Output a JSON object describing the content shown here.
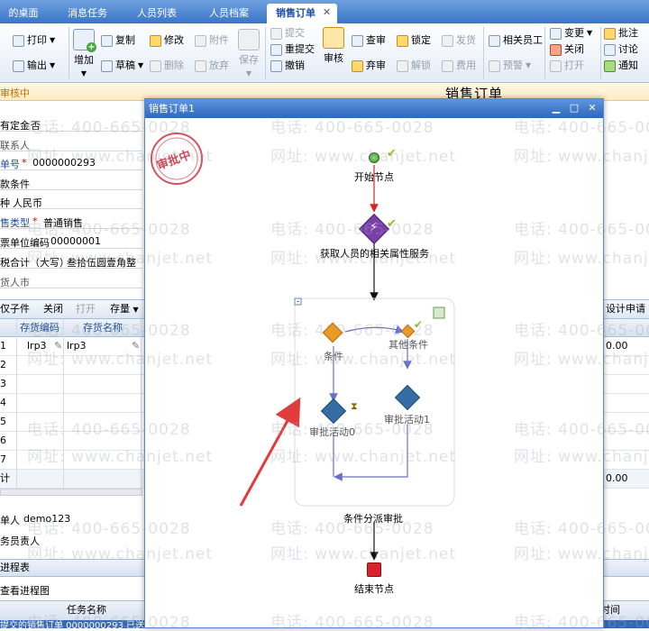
{
  "tabs": [
    {
      "label": "的桌面"
    },
    {
      "label": "消息任务"
    },
    {
      "label": "人员列表"
    },
    {
      "label": "人员档案"
    },
    {
      "label": "销售订单",
      "active": true
    }
  ],
  "toolbar": {
    "print": "打印",
    "export": "输出",
    "add": "增加",
    "copy": "复制",
    "draft": "草稿",
    "modify": "修改",
    "delete": "删除",
    "attach": "附件",
    "discard": "放弃",
    "save": "保存",
    "submit": "提交",
    "resubmit": "重提交",
    "withdraw": "撤销",
    "audit": "审核",
    "review": "查审",
    "abandon_audit": "弃审",
    "lock": "锁定",
    "unlock": "解锁",
    "ship": "发货",
    "expense": "费用",
    "related_staff": "相关员工",
    "warning": "预警",
    "change": "变更",
    "close": "关闭",
    "open": "打开",
    "annotate": "批注",
    "discuss": "讨论",
    "notify": "通知"
  },
  "form": {
    "title": "销售订单",
    "status": "审核中",
    "deposit_label": "有定金",
    "deposit_value": "否",
    "contact_label": "联系人",
    "order_no_label": "单号",
    "order_no_value": "0000000293",
    "payment_terms_label": "款条件",
    "currency_label": "种",
    "currency_value": "人民币",
    "biz_type_label": "售类型",
    "biz_type_value": "普通销售",
    "invoice_unit_label": "票单位编码",
    "invoice_unit_value": "00000001",
    "total_upper_label": "税合计（大写）",
    "total_upper_value": "叁拾伍圆壹角整",
    "city_label": "货人市",
    "maker_label": "单人",
    "maker_value": "demo123",
    "owner_label": "务员责人",
    "progress_label": "进程表",
    "view_progress": "查看进程图",
    "task_name_header": "任务名称",
    "time_header": "时间",
    "task_row_text": "提交的销售订单 0000000293 已送"
  },
  "grid": {
    "toolbar": {
      "subpart": "仅子件",
      "close": "关闭",
      "open": "打开",
      "stock": "存量",
      "design": "设计申请"
    },
    "headers": {
      "code": "存货编码",
      "name": "存货名称"
    },
    "rows": [
      {
        "no": "1",
        "code": "lrp3",
        "name": "lrp3",
        "amount": "0.00"
      },
      {
        "no": "2"
      },
      {
        "no": "3"
      },
      {
        "no": "4"
      },
      {
        "no": "5"
      },
      {
        "no": "6"
      },
      {
        "no": "7"
      }
    ],
    "total_label": "计",
    "total_value": "0.00"
  },
  "dialog": {
    "title": "销售订单1",
    "stamp": "审批中",
    "nodes": {
      "start": "开始节点",
      "service": "获取人员的相关属性服务",
      "condition": "条件",
      "other_condition": "其他条件",
      "approve0": "审批活动0",
      "approve1": "审批活动1",
      "dispatch": "条件分派审批",
      "end": "结束节点"
    }
  },
  "watermarks": {
    "phone": "电话: 400-665-0028",
    "site": "网址: www.chanjet.net"
  },
  "colors": {
    "tab_bar": "#3a75c7",
    "title_bar": "#2f68bd",
    "stamp_red": "#c8283a",
    "service_purple": "#7a3fa8",
    "condition_orange": "#f09a1a",
    "approve_blue": "#356ca3",
    "end_red": "#d9232a",
    "arrow_red": "#e23b3b"
  }
}
